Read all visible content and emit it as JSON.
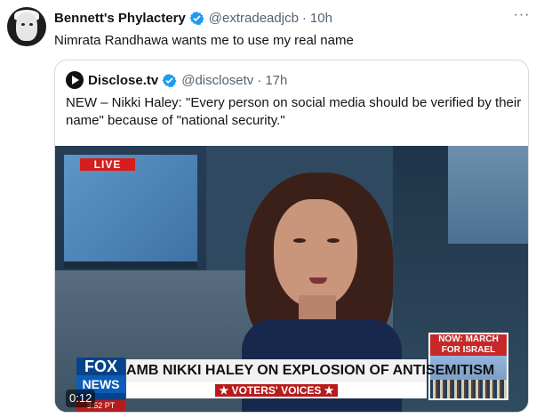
{
  "tweet": {
    "author_name": "Bennett's Phylactery",
    "author_handle": "@extradeadjcb",
    "separator": "·",
    "time": "10h",
    "more_label": "···",
    "text": "Nimrata Randhawa wants me to use my real name",
    "colors": {
      "verified": "#1d9bf0",
      "muted": "#536471",
      "text": "#0f1419"
    }
  },
  "quote": {
    "author_name": "Disclose.tv",
    "author_handle": "@disclosetv",
    "separator": "·",
    "time": "17h",
    "text": "NEW – Nikki Haley: \"Every person on social media should be verified by their name\" because of \"national security.\""
  },
  "video": {
    "live_label": "LIVE",
    "logo_fox": "FOX",
    "logo_news": "NEWS",
    "headline": "AMB NIKKI HALEY ON EXPLOSION OF ANTISEMITISM",
    "subheadline": "★ VOTERS' VOICES ★",
    "promo_title": "NOW: MARCH FOR ISRAEL",
    "clock": "3:52 PT",
    "timestamp": "0:12",
    "icons": [
      "play-icon",
      "verified-badge-icon",
      "more-icon"
    ]
  }
}
